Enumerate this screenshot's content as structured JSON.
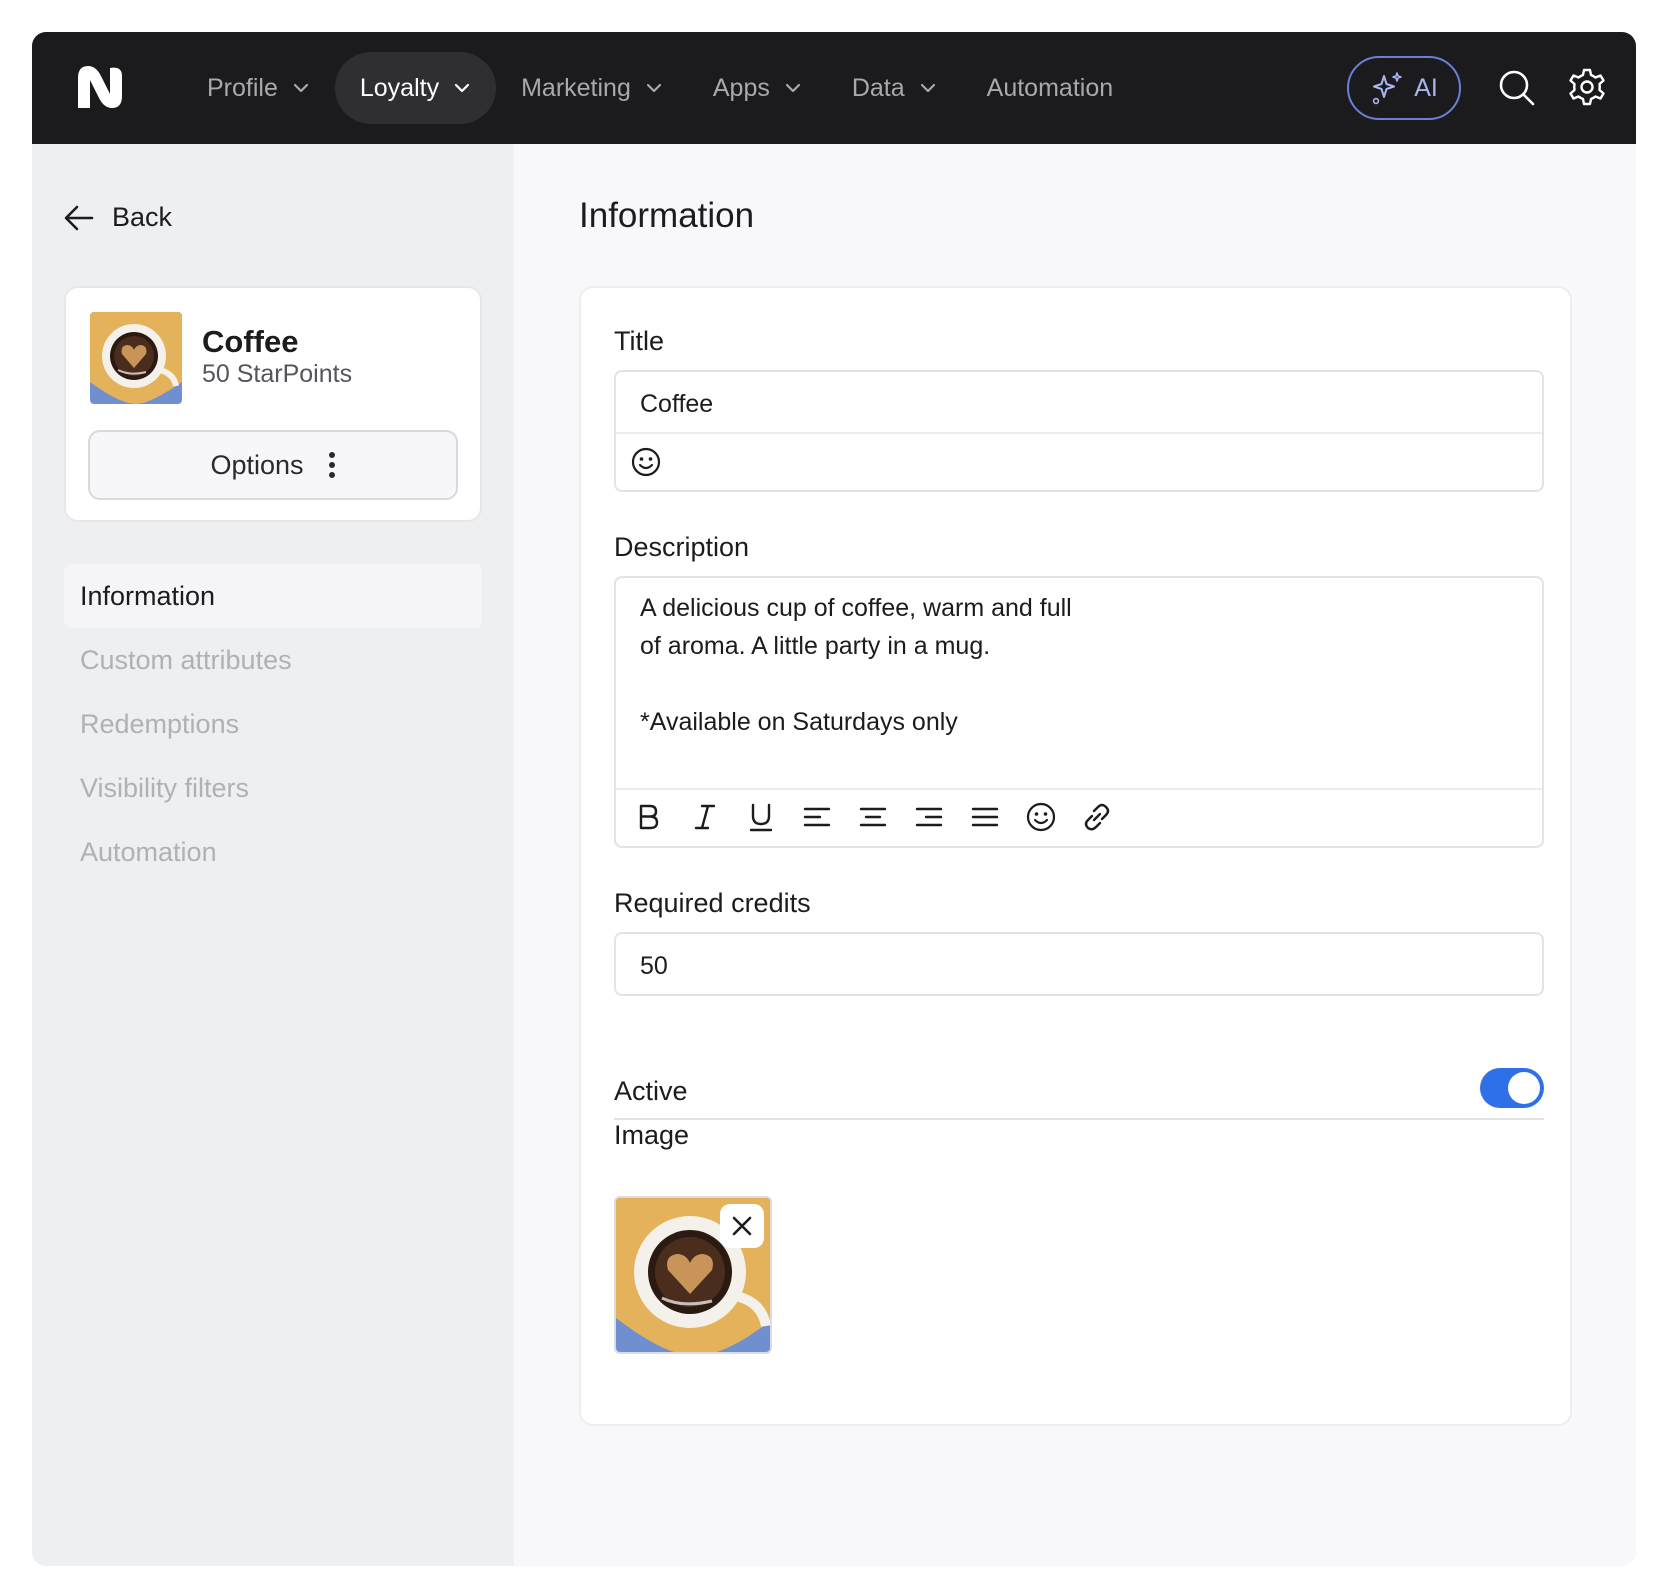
{
  "nav": {
    "items": [
      {
        "label": "Profile",
        "has_chevron": true
      },
      {
        "label": "Loyalty",
        "has_chevron": true,
        "active": true
      },
      {
        "label": "Marketing",
        "has_chevron": true
      },
      {
        "label": "Apps",
        "has_chevron": true
      },
      {
        "label": "Data",
        "has_chevron": true
      },
      {
        "label": "Automation",
        "has_chevron": false
      }
    ],
    "ai_label": "AI",
    "icons": [
      "sparkles-icon",
      "search-icon",
      "gear-icon"
    ]
  },
  "sidebar": {
    "back_label": "Back",
    "card": {
      "title": "Coffee",
      "subtitle": "50 StarPoints",
      "options_label": "Options"
    },
    "items": [
      {
        "label": "Information",
        "active": true
      },
      {
        "label": "Custom attributes"
      },
      {
        "label": "Redemptions"
      },
      {
        "label": "Visibility filters"
      },
      {
        "label": "Automation"
      }
    ]
  },
  "main": {
    "page_title": "Information",
    "title_field": {
      "label": "Title",
      "value": "Coffee"
    },
    "description_field": {
      "label": "Description",
      "line1": "A delicious cup of coffee, warm and full",
      "line2": "of aroma. A little party in a mug.",
      "line3": "*Available on Saturdays only"
    },
    "credits_field": {
      "label": "Required credits",
      "value": "50"
    },
    "active": {
      "label": "Active",
      "value": true
    },
    "image": {
      "label": "Image"
    }
  },
  "colors": {
    "topbar": "#1b1b1d",
    "toggle_on": "#2f6fe8",
    "ai_border": "#6b7fd6"
  }
}
